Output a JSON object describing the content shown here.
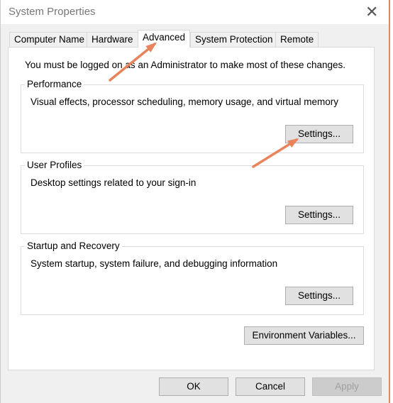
{
  "window": {
    "title": "System Properties",
    "close_icon": "close-icon"
  },
  "tabs": [
    {
      "label": "Computer Name"
    },
    {
      "label": "Hardware"
    },
    {
      "label": "Advanced",
      "active": true
    },
    {
      "label": "System Protection"
    },
    {
      "label": "Remote"
    }
  ],
  "notice": "You must be logged on as an Administrator to make most of these changes.",
  "groups": [
    {
      "title": "Performance",
      "description": "Visual effects, processor scheduling, memory usage, and virtual memory",
      "button": "Settings..."
    },
    {
      "title": "User Profiles",
      "description": "Desktop settings related to your sign-in",
      "button": "Settings..."
    },
    {
      "title": "Startup and Recovery",
      "description": "System startup, system failure, and debugging information",
      "button": "Settings..."
    }
  ],
  "env_button": "Environment Variables...",
  "footer": {
    "ok": "OK",
    "cancel": "Cancel",
    "apply": "Apply"
  },
  "annotation_color": "#e8835b"
}
